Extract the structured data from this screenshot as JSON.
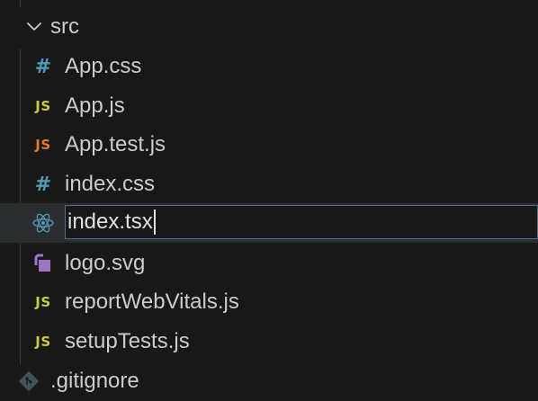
{
  "explorer": {
    "folder": {
      "name": "src",
      "expanded": true,
      "icon": "chevron-down-icon"
    },
    "files": [
      {
        "name": "App.css",
        "icon": "css-hash-icon",
        "icon_text": "#",
        "icon_color": "#519aba"
      },
      {
        "name": "App.js",
        "icon": "js-icon",
        "icon_text": "JS",
        "icon_color": "#cbcb41"
      },
      {
        "name": "App.test.js",
        "icon": "js-test-icon",
        "icon_text": "JS",
        "icon_color": "#e37933"
      },
      {
        "name": "index.css",
        "icon": "css-hash-icon",
        "icon_text": "#",
        "icon_color": "#519aba"
      },
      {
        "name": "index.tsx",
        "icon": "react-icon",
        "icon_color": "#519aba",
        "renaming": true
      },
      {
        "name": "logo.svg",
        "icon": "svg-image-icon",
        "icon_color": "#a074c4"
      },
      {
        "name": "reportWebVitals.js",
        "icon": "js-icon",
        "icon_text": "JS",
        "icon_color": "#cbcb41"
      },
      {
        "name": "setupTests.js",
        "icon": "js-icon",
        "icon_text": "JS",
        "icon_color": "#cbcb41"
      }
    ],
    "root_files": [
      {
        "name": ".gitignore",
        "icon": "git-icon",
        "icon_color": "#41535b"
      }
    ]
  }
}
